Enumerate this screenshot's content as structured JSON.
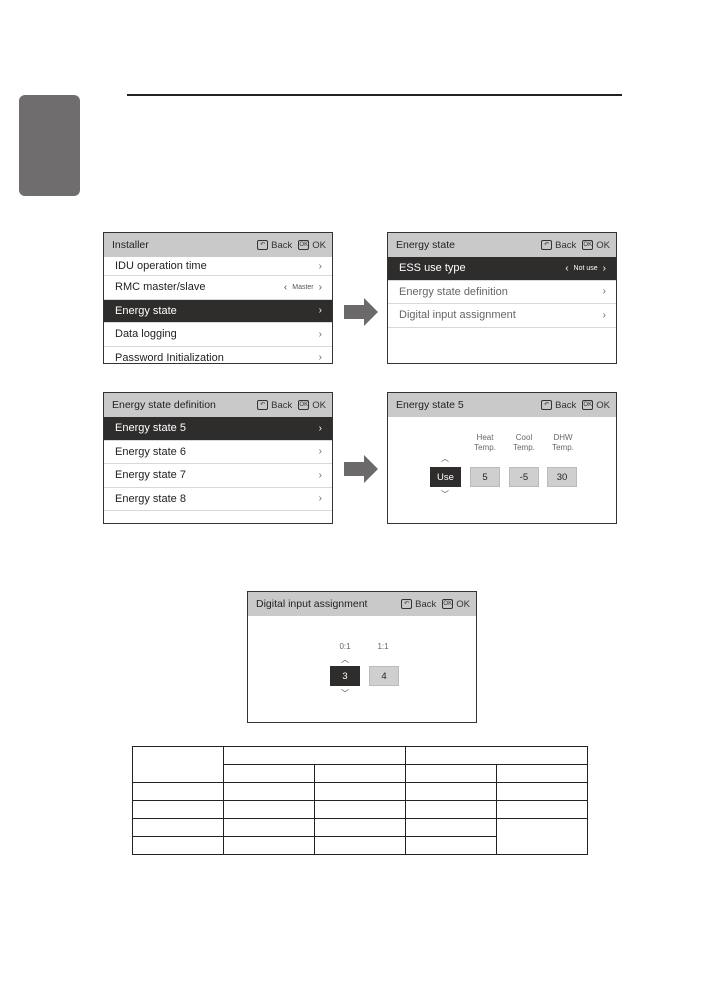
{
  "page": {
    "side_tab_color": "#6f6d6d"
  },
  "screens": {
    "installer": {
      "title": "Installer",
      "back_label": "Back",
      "ok_label": "OK",
      "items": [
        {
          "label": "IDU operation time",
          "chevron": ">"
        },
        {
          "label": "RMC master/slave",
          "value": "Master",
          "chevron": ">"
        },
        {
          "label": "Energy state",
          "chevron": ">",
          "selected": true
        },
        {
          "label": "Data logging",
          "chevron": ">"
        },
        {
          "label": "Password Initialization",
          "chevron": ">"
        }
      ]
    },
    "energy_state": {
      "title": "Energy state",
      "back_label": "Back",
      "ok_label": "OK",
      "items": [
        {
          "label": "ESS use type",
          "value": "Not use",
          "selected": true
        },
        {
          "label": "Energy state definition",
          "chevron": ">"
        },
        {
          "label": "Digital input assignment",
          "chevron": ">"
        }
      ]
    },
    "energy_state_definition": {
      "title": "Energy state definition",
      "back_label": "Back",
      "ok_label": "OK",
      "items": [
        {
          "label": "Energy state 5",
          "chevron": ">",
          "selected": true
        },
        {
          "label": "Energy state 6",
          "chevron": ">"
        },
        {
          "label": "Energy state 7",
          "chevron": ">"
        },
        {
          "label": "Energy state 8",
          "chevron": ">"
        }
      ]
    },
    "energy_state_5": {
      "title": "Energy state 5",
      "back_label": "Back",
      "ok_label": "OK",
      "use_value": "Use",
      "columns": [
        {
          "label_line1": "Heat",
          "label_line2": "Temp.",
          "value": "5"
        },
        {
          "label_line1": "Cool",
          "label_line2": "Temp.",
          "value": "-5"
        },
        {
          "label_line1": "DHW",
          "label_line2": "Temp.",
          "value": "30"
        }
      ]
    },
    "digital_input_assignment": {
      "title": "Digital input assignment",
      "back_label": "Back",
      "ok_label": "OK",
      "columns": [
        {
          "label": "0:1",
          "value": "3",
          "selected": true
        },
        {
          "label": "1:1",
          "value": "4"
        }
      ]
    }
  },
  "icons": {
    "back": "back-arrow-icon",
    "ok": "ok-icon",
    "chevron_left": "<",
    "chevron_right": ">",
    "up": "^",
    "down": "v"
  },
  "back_glyph": "⮌",
  "ok_glyph": "OK",
  "chev_left": "‹",
  "chev_right": "›",
  "caret_up": "︿",
  "caret_down": "﹀"
}
